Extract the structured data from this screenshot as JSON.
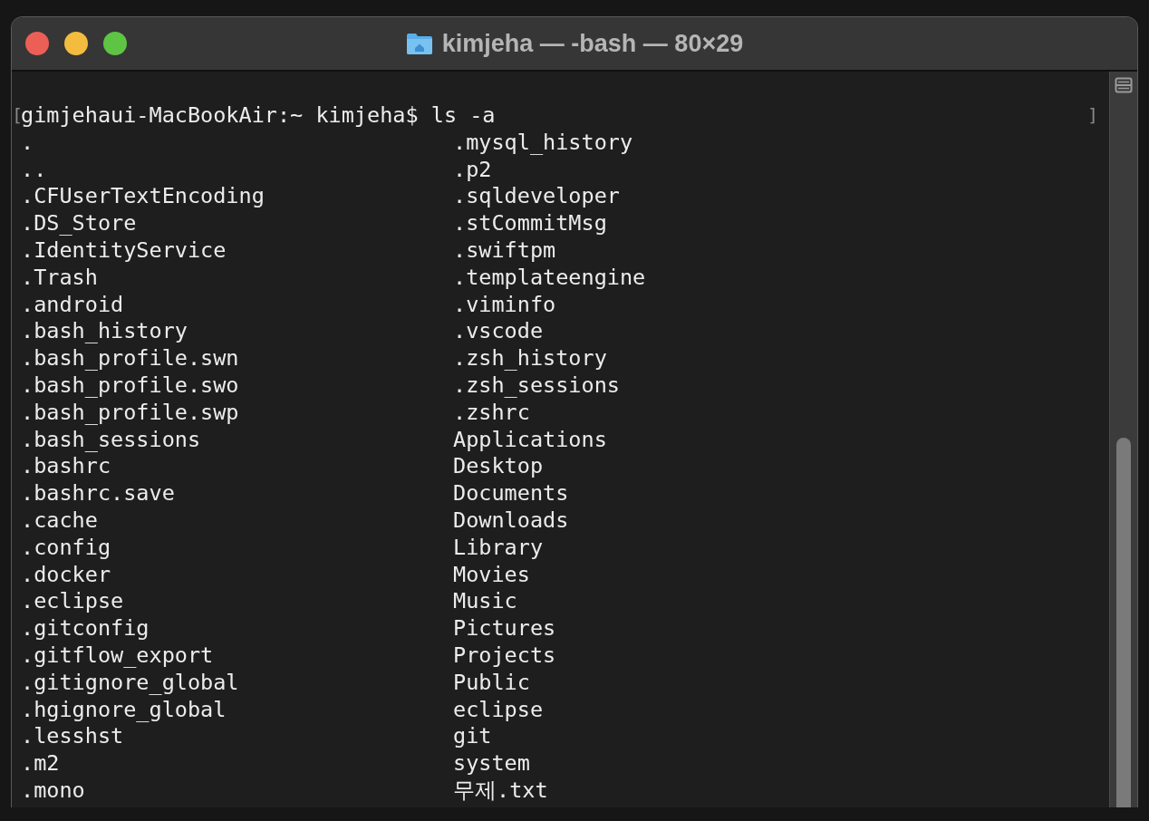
{
  "window": {
    "title": "kimjeha — -bash — 80×29"
  },
  "terminal": {
    "prompt_mark_open": "[",
    "prompt": "gimjehaui-MacBookAir:~ kimjeha$ ls -a",
    "prompt_mark_close": "]",
    "listing": [
      [
        ".",
        ".mysql_history"
      ],
      [
        "..",
        ".p2"
      ],
      [
        ".CFUserTextEncoding",
        ".sqldeveloper"
      ],
      [
        ".DS_Store",
        ".stCommitMsg"
      ],
      [
        ".IdentityService",
        ".swiftpm"
      ],
      [
        ".Trash",
        ".templateengine"
      ],
      [
        ".android",
        ".viminfo"
      ],
      [
        ".bash_history",
        ".vscode"
      ],
      [
        ".bash_profile.swn",
        ".zsh_history"
      ],
      [
        ".bash_profile.swo",
        ".zsh_sessions"
      ],
      [
        ".bash_profile.swp",
        ".zshrc"
      ],
      [
        ".bash_sessions",
        "Applications"
      ],
      [
        ".bashrc",
        "Desktop"
      ],
      [
        ".bashrc.save",
        "Documents"
      ],
      [
        ".cache",
        "Downloads"
      ],
      [
        ".config",
        "Library"
      ],
      [
        ".docker",
        "Movies"
      ],
      [
        ".eclipse",
        "Music"
      ],
      [
        ".gitconfig",
        "Pictures"
      ],
      [
        ".gitflow_export",
        "Projects"
      ],
      [
        ".gitignore_global",
        "Public"
      ],
      [
        ".hgignore_global",
        "eclipse"
      ],
      [
        ".lesshst",
        "git"
      ],
      [
        ".m2",
        "system"
      ],
      [
        ".mono",
        "무제.txt"
      ]
    ]
  }
}
